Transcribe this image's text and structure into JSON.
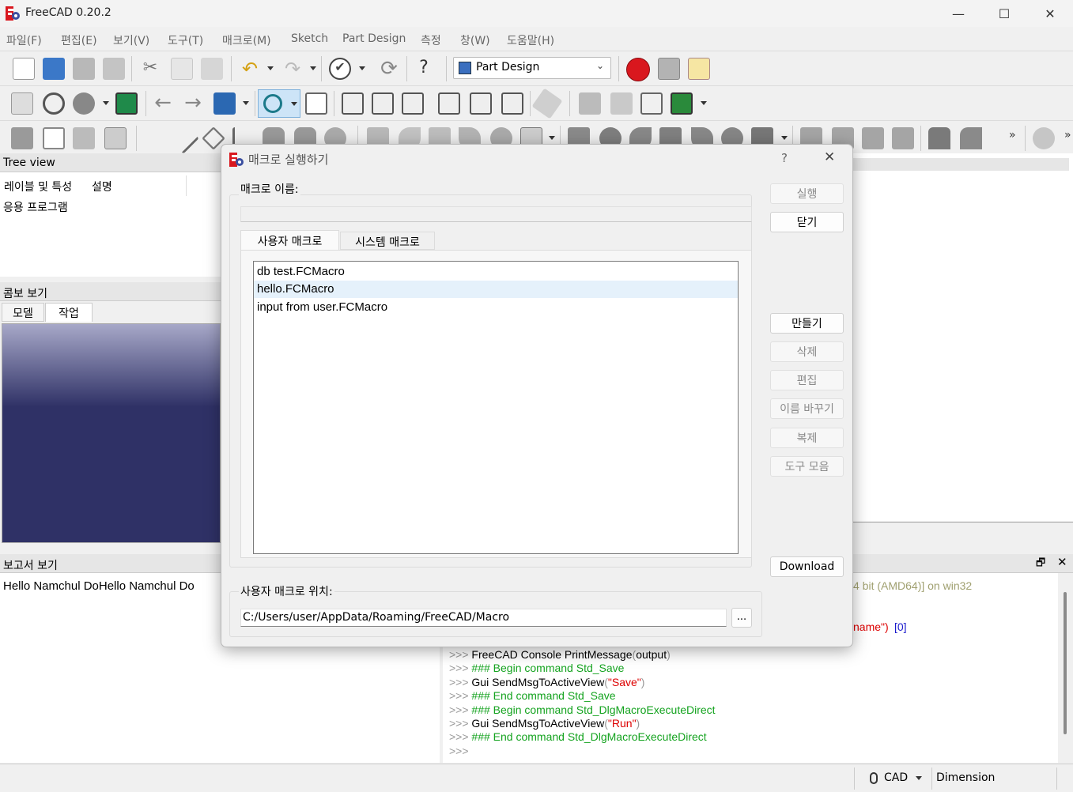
{
  "window": {
    "title": "FreeCAD 0.20.2",
    "minimize": "—",
    "maximize": "☐",
    "close": "✕"
  },
  "menu": [
    "파일(F)",
    "편집(E)",
    "보기(V)",
    "도구(T)",
    "매크로(M)",
    "Sketch",
    "Part Design",
    "측정",
    "창(W)",
    "도움말(H)"
  ],
  "workbench": {
    "selected": "Part Design"
  },
  "colors": {
    "accent": "#2f3166",
    "record": "#d9171e",
    "play": "#3aa415",
    "console_green": "#14a31f",
    "console_red": "#dd0000"
  },
  "tree_view": {
    "title": "Tree view",
    "columns": [
      "레이블 및 특성",
      "설명"
    ],
    "items": [
      "응용 프로그램"
    ]
  },
  "combo_view": {
    "title": "콤보 보기",
    "tabs": [
      "모델",
      "작업"
    ]
  },
  "report_view": {
    "title": "보고서 보기",
    "text": "Hello Namchul DoHello Namchul Do"
  },
  "python_console": {
    "partial": [
      {
        "text": "4 bit (AMD64)] on win32",
        "color": "gray"
      },
      {
        "text": " name\")",
        "color": "red"
      },
      {
        "text": "[0]",
        "color": "blue"
      }
    ],
    "lines": [
      {
        "prompt": ">>> ",
        "parts": [
          {
            "t": "FreeCAD Console PrintMessage",
            "c": ""
          },
          {
            "t": "(",
            "c": "p"
          },
          {
            "t": "output",
            "c": ""
          },
          {
            "t": ")",
            "c": "p"
          }
        ]
      },
      {
        "prompt": ">>> ",
        "parts": [
          {
            "t": "### Begin command Std_Save",
            "c": "g"
          }
        ]
      },
      {
        "prompt": ">>> ",
        "parts": [
          {
            "t": "Gui SendMsgToActiveView",
            "c": ""
          },
          {
            "t": "(",
            "c": "p"
          },
          {
            "t": "\"Save\"",
            "c": "r"
          },
          {
            "t": ")",
            "c": "p"
          }
        ]
      },
      {
        "prompt": ">>> ",
        "parts": [
          {
            "t": "### End command Std_Save",
            "c": "g"
          }
        ]
      },
      {
        "prompt": ">>> ",
        "parts": [
          {
            "t": "### Begin command Std_DlgMacroExecuteDirect",
            "c": "g"
          }
        ]
      },
      {
        "prompt": ">>> ",
        "parts": [
          {
            "t": "Gui SendMsgToActiveView",
            "c": ""
          },
          {
            "t": "(",
            "c": "p"
          },
          {
            "t": "\"Run\"",
            "c": "r"
          },
          {
            "t": ")",
            "c": "p"
          }
        ]
      },
      {
        "prompt": ">>> ",
        "parts": [
          {
            "t": "### End command Std_DlgMacroExecuteDirect",
            "c": "g"
          }
        ]
      },
      {
        "prompt": ">>> ",
        "parts": []
      }
    ]
  },
  "status_bar": {
    "nav_style": "CAD",
    "units": "Dimension"
  },
  "dialog": {
    "title": "매크로 실행하기",
    "help": "?",
    "close": "✕",
    "macro_name_label": "매크로 이름:",
    "macro_name_value": "",
    "tabs": [
      "사용자 매크로",
      "시스템 매크로"
    ],
    "macros": [
      "db test.FCMacro",
      "hello.FCMacro",
      "input from user.FCMacro"
    ],
    "selected_index": 1,
    "location_label": "사용자 매크로 위치:",
    "location_value": "C:/Users/user/AppData/Roaming/FreeCAD/Macro",
    "browse": "...",
    "buttons": {
      "execute": "실행",
      "close": "닫기",
      "create": "만들기",
      "delete": "삭제",
      "edit": "편집",
      "rename": "이름 바꾸기",
      "duplicate": "복제",
      "toolbar": "도구 모음",
      "download": "Download"
    }
  }
}
